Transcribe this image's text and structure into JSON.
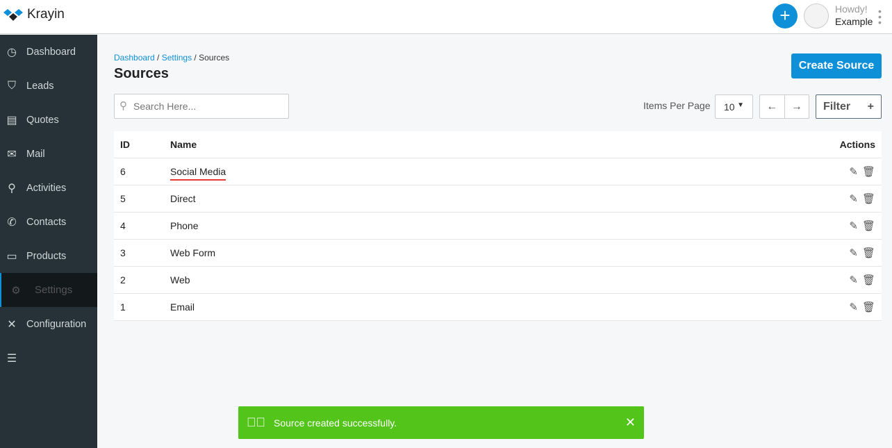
{
  "app": {
    "name": "Krayin"
  },
  "header": {
    "howdy": "Howdy!",
    "user": "Example"
  },
  "sidebar": {
    "items": [
      {
        "label": "Dashboard",
        "icon": "◷"
      },
      {
        "label": "Leads",
        "icon": "⛉"
      },
      {
        "label": "Quotes",
        "icon": "▤"
      },
      {
        "label": "Mail",
        "icon": "✉"
      },
      {
        "label": "Activities",
        "icon": "⚲"
      },
      {
        "label": "Contacts",
        "icon": "✆"
      },
      {
        "label": "Products",
        "icon": "▭"
      },
      {
        "label": "Settings",
        "icon": "⚙"
      },
      {
        "label": "Configuration",
        "icon": "✕"
      }
    ]
  },
  "breadcrumb": [
    "Dashboard",
    "Settings",
    "Sources"
  ],
  "page": {
    "title": "Sources",
    "create": "Create Source",
    "search_placeholder": "Search Here...",
    "items_per_page": "Items Per Page",
    "per_page_value": "10",
    "filter": "Filter"
  },
  "table": {
    "headers": [
      "ID",
      "Name",
      "Actions"
    ],
    "rows": [
      {
        "id": "6",
        "name": "Social Media"
      },
      {
        "id": "5",
        "name": "Direct"
      },
      {
        "id": "4",
        "name": "Phone"
      },
      {
        "id": "3",
        "name": "Web Form"
      },
      {
        "id": "2",
        "name": "Web"
      },
      {
        "id": "1",
        "name": "Email"
      }
    ]
  },
  "toast": {
    "message": "Source created successfully."
  },
  "colors": {
    "accent": "#0e90d9",
    "sidebar": "#263238",
    "success": "#52c41a"
  }
}
